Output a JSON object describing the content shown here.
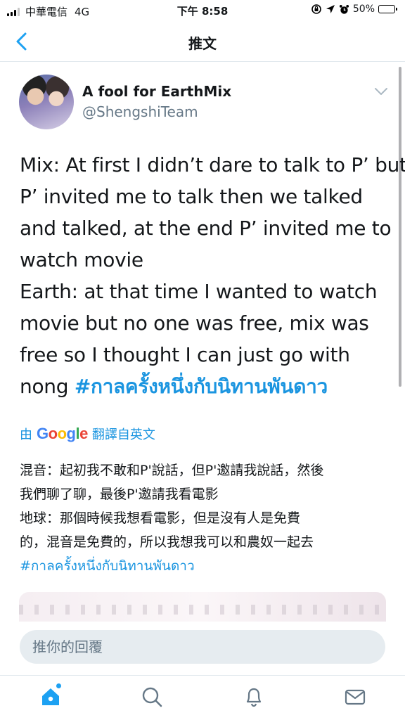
{
  "status_bar": {
    "carrier": "中華電信",
    "network": "4G",
    "time": "下午 8:58",
    "battery_percent": "50%",
    "battery_level": 0.5,
    "icons": [
      "screen-rotation-lock-icon",
      "location-icon",
      "alarm-icon",
      "battery-icon"
    ]
  },
  "nav": {
    "title": "推文",
    "back_icon": "chevron-left-icon"
  },
  "tweet": {
    "display_name": "A fool for EarthMix",
    "handle": "@ShengshiTeam",
    "lines": [
      "Mix: At first I didn’t dare to talk to P’ but",
      "P’ invited me to talk then we talked",
      "and talked, at the end P’ invited me to",
      "watch movie",
      "Earth: at that time I wanted to watch",
      "movie but no one was free, mix was",
      "free so I thought I can just go with"
    ],
    "last_line_prefix": "nong ",
    "hashtag": "#กาลครั้งหนึ่งกับนิทานพันดาว"
  },
  "translation": {
    "by": "由",
    "provider": "Google",
    "label": "翻譯自英文",
    "lines": [
      "混音：起初我不敢和P'說話，但P'邀請我說話，然後",
      "我們聊了聊，最後P'邀請我看電影",
      "地球：那個時候我想看電影，但是沒有人是免費",
      "的，混音是免費的，所以我想我可以和農奴一起去"
    ],
    "hashtag": "#กาลครั้งหนึ่งกับนิทานพันดาว"
  },
  "reply": {
    "placeholder": "推你的回覆"
  },
  "tabs": [
    {
      "name": "home",
      "icon": "home-icon",
      "has_notification_dot": true
    },
    {
      "name": "search",
      "icon": "search-icon"
    },
    {
      "name": "notifications",
      "icon": "bell-icon"
    },
    {
      "name": "messages",
      "icon": "mail-icon"
    }
  ],
  "colors": {
    "accent": "#1da1f2",
    "link": "#1b95e0",
    "text": "#14171a",
    "secondary": "#657786",
    "battery": "#4cd964"
  }
}
